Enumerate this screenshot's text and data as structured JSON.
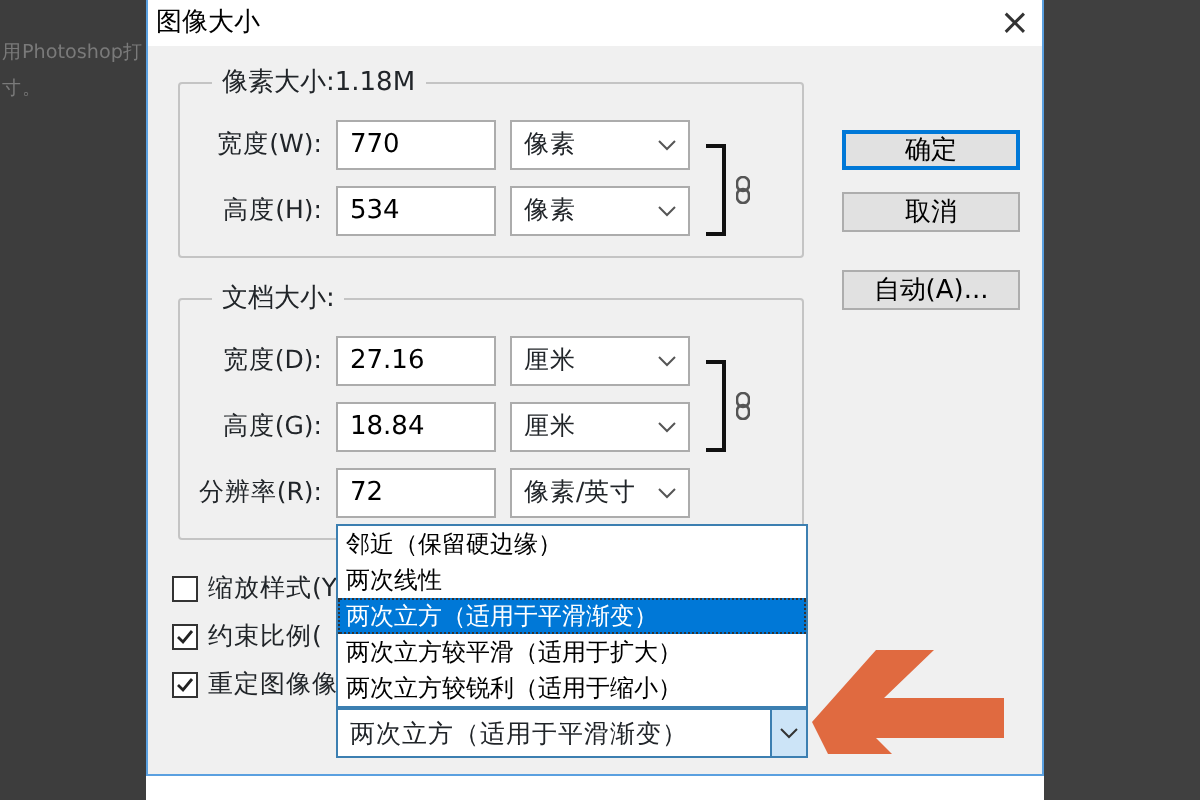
{
  "background_text": [
    "用Photoshop打",
    "寸。"
  ],
  "window": {
    "title": "图像大小",
    "close": "×"
  },
  "groups": [
    {
      "title": "像素大小:1.18M",
      "rows": [
        {
          "label": "宽度(W):",
          "value": "770",
          "unit": "像素",
          "linked": true
        },
        {
          "label": "高度(H):",
          "value": "534",
          "unit": "像素",
          "linked": true
        }
      ]
    },
    {
      "title": "文档大小:",
      "rows": [
        {
          "label": "宽度(D):",
          "value": "27.16",
          "unit": "厘米",
          "linked": true
        },
        {
          "label": "高度(G):",
          "value": "18.84",
          "unit": "厘米",
          "linked": true
        },
        {
          "label": "分辨率(R):",
          "value": "72",
          "unit": "像素/英寸",
          "linked": false
        }
      ]
    }
  ],
  "buttons": [
    {
      "label": "确定",
      "focused": true
    },
    {
      "label": "取消",
      "focused": false
    },
    {
      "label": "自动(A)...",
      "focused": false
    }
  ],
  "checkboxes": [
    {
      "label": "缩放样式(Y",
      "checked": false
    },
    {
      "label": "约束比例(",
      "checked": true
    },
    {
      "label": "重定图像像",
      "checked": true
    }
  ],
  "resample": {
    "value": "两次立方（适用于平滑渐变）",
    "expanded": true,
    "options": [
      {
        "label": "邻近（保留硬边缘）",
        "selected": false
      },
      {
        "label": "两次线性",
        "selected": false
      },
      {
        "label": "两次立方（适用于平滑渐变）",
        "selected": true
      },
      {
        "label": "两次立方较平滑（适用于扩大）",
        "selected": false
      },
      {
        "label": "两次立方较锐利（适用于缩小）",
        "selected": false
      }
    ]
  }
}
